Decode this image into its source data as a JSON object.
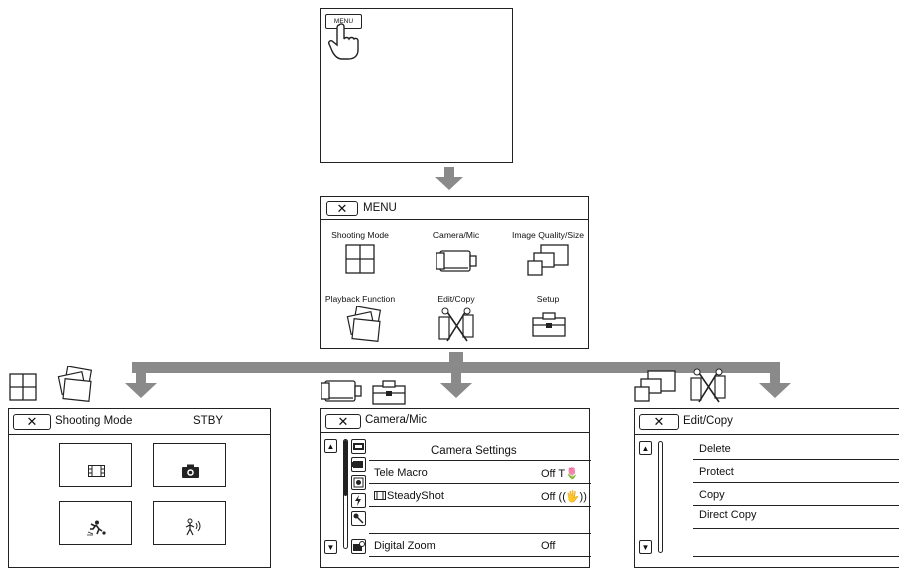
{
  "step1": {
    "menu_button": "MENU"
  },
  "menu": {
    "close": "✕",
    "title": "MENU",
    "items": [
      {
        "label": "Shooting Mode"
      },
      {
        "label": "Camera/Mic"
      },
      {
        "label": "Image Quality/Size"
      },
      {
        "label": "Playback Function"
      },
      {
        "label": "Edit/Copy"
      },
      {
        "label": "Setup"
      }
    ]
  },
  "shooting": {
    "close": "✕",
    "title": "Shooting Mode",
    "status": "STBY"
  },
  "camera": {
    "close": "✕",
    "title": "Camera/Mic",
    "section": "Camera Settings",
    "rows": [
      {
        "label": "Tele Macro",
        "value": "Off T🌷"
      },
      {
        "label": "SteadyShot",
        "value": "Off ((🖐))"
      },
      {
        "label": "",
        "value": ""
      },
      {
        "label": "Digital Zoom",
        "value": "Off"
      }
    ]
  },
  "edit": {
    "close": "✕",
    "title": "Edit/Copy",
    "rows": [
      {
        "label": "Delete"
      },
      {
        "label": "Protect"
      },
      {
        "label": "Copy"
      },
      {
        "label": "Direct Copy"
      }
    ]
  },
  "colors": {
    "arrow": "#8a8a8a",
    "line": "#222222"
  }
}
